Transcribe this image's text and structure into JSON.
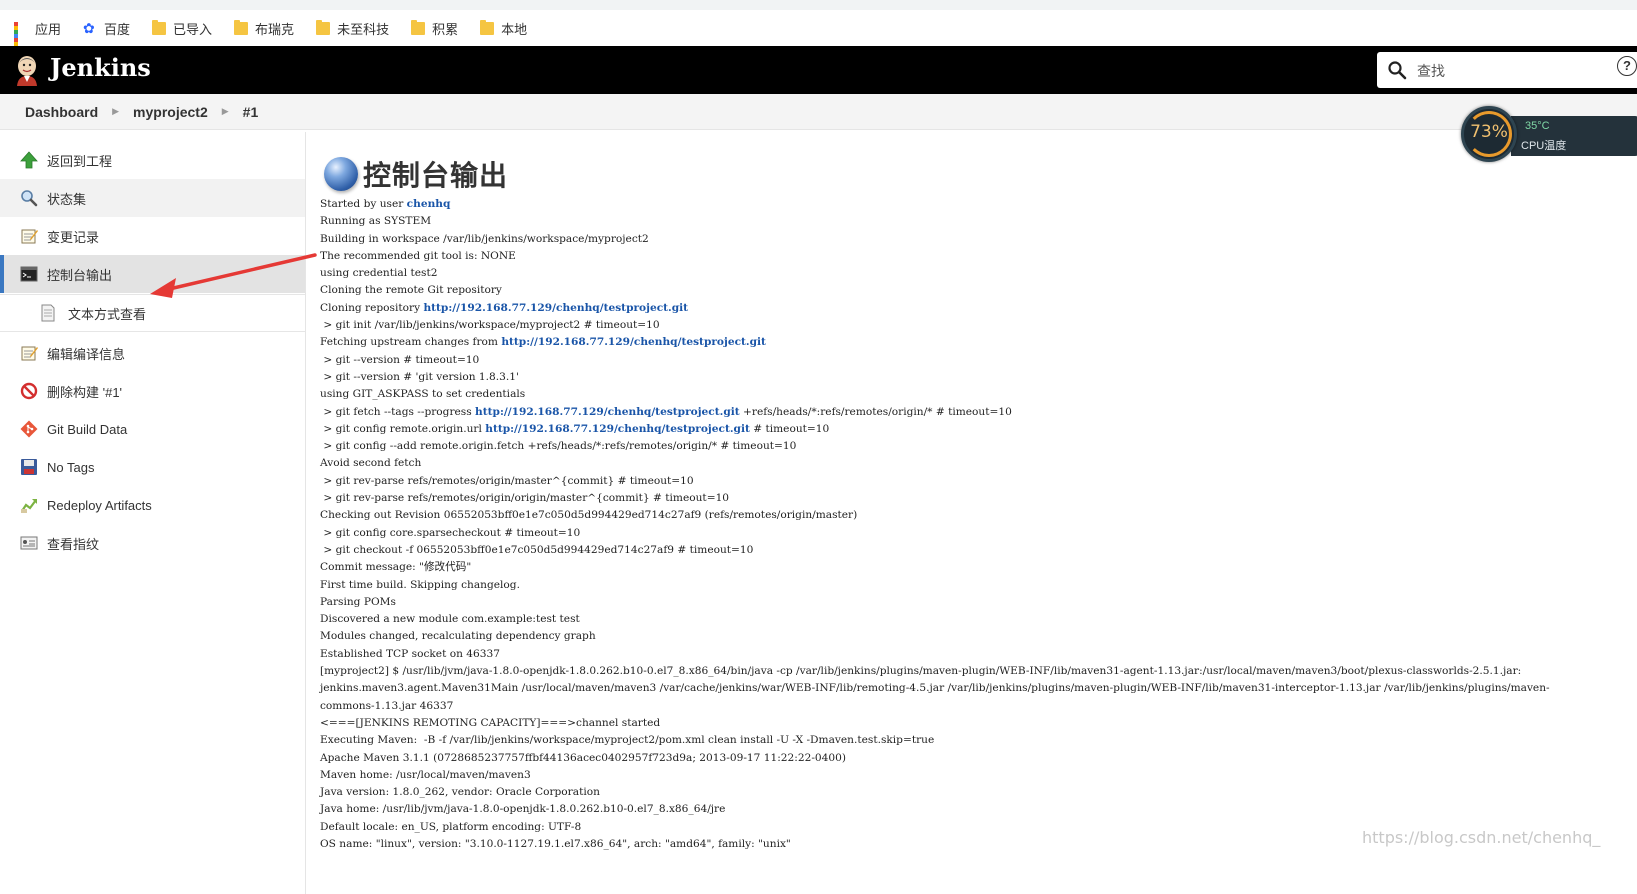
{
  "bookmarks": [
    {
      "label": "应用",
      "icon": "apps-grid-icon"
    },
    {
      "label": "百度",
      "icon": "baidu-paw-icon"
    },
    {
      "label": "已导入",
      "icon": "folder-icon"
    },
    {
      "label": "布瑞克",
      "icon": "folder-icon"
    },
    {
      "label": "未至科技",
      "icon": "folder-icon"
    },
    {
      "label": "积累",
      "icon": "folder-icon"
    },
    {
      "label": "本地",
      "icon": "folder-icon"
    }
  ],
  "header": {
    "brand": "Jenkins",
    "search_placeholder": "查找",
    "help": "?"
  },
  "breadcrumb": [
    "Dashboard",
    "myproject2",
    "#1"
  ],
  "sidebar": {
    "items": [
      {
        "label": "返回到工程",
        "icon": "up-arrow-icon"
      },
      {
        "label": "状态集",
        "icon": "magnifier-icon"
      },
      {
        "label": "变更记录",
        "icon": "notepad-icon"
      },
      {
        "label": "控制台输出",
        "icon": "terminal-icon"
      },
      {
        "label": "文本方式查看",
        "icon": "document-icon"
      },
      {
        "label": "编辑编译信息",
        "icon": "notepad-icon"
      },
      {
        "label": "删除构建 '#1'",
        "icon": "no-entry-icon"
      },
      {
        "label": "Git Build Data",
        "icon": "git-icon"
      },
      {
        "label": "No Tags",
        "icon": "floppy-icon"
      },
      {
        "label": "Redeploy Artifacts",
        "icon": "redeploy-icon"
      },
      {
        "label": "查看指纹",
        "icon": "fingerprint-card-icon"
      }
    ]
  },
  "main": {
    "title": "控制台输出",
    "console": [
      {
        "pre": "Started by user ",
        "link": "chenhq",
        "post": ""
      },
      {
        "pre": "Running as SYSTEM"
      },
      {
        "pre": "Building in workspace /var/lib/jenkins/workspace/myproject2"
      },
      {
        "pre": "The recommended git tool is: NONE"
      },
      {
        "pre": "using credential test2"
      },
      {
        "pre": "Cloning the remote Git repository"
      },
      {
        "pre": "Cloning repository ",
        "link": "http://192.168.77.129/chenhq/testproject.git",
        "post": ""
      },
      {
        "pre": " > git init /var/lib/jenkins/workspace/myproject2 # timeout=10"
      },
      {
        "pre": "Fetching upstream changes from ",
        "link": "http://192.168.77.129/chenhq/testproject.git",
        "post": ""
      },
      {
        "pre": " > git --version # timeout=10"
      },
      {
        "pre": " > git --version # 'git version 1.8.3.1'"
      },
      {
        "pre": "using GIT_ASKPASS to set credentials"
      },
      {
        "pre": " > git fetch --tags --progress ",
        "link": "http://192.168.77.129/chenhq/testproject.git",
        "post": " +refs/heads/*:refs/remotes/origin/* # timeout=10"
      },
      {
        "pre": " > git config remote.origin.url ",
        "link": "http://192.168.77.129/chenhq/testproject.git",
        "post": " # timeout=10"
      },
      {
        "pre": " > git config --add remote.origin.fetch +refs/heads/*:refs/remotes/origin/* # timeout=10"
      },
      {
        "pre": "Avoid second fetch"
      },
      {
        "pre": " > git rev-parse refs/remotes/origin/master^{commit} # timeout=10"
      },
      {
        "pre": " > git rev-parse refs/remotes/origin/origin/master^{commit} # timeout=10"
      },
      {
        "pre": "Checking out Revision 06552053bff0e1e7c050d5d994429ed714c27af9 (refs/remotes/origin/master)"
      },
      {
        "pre": " > git config core.sparsecheckout # timeout=10"
      },
      {
        "pre": " > git checkout -f 06552053bff0e1e7c050d5d994429ed714c27af9 # timeout=10"
      },
      {
        "pre": "Commit message: \"修改代码\""
      },
      {
        "pre": "First time build. Skipping changelog."
      },
      {
        "pre": "Parsing POMs"
      },
      {
        "pre": "Discovered a new module com.example:test test"
      },
      {
        "pre": "Modules changed, recalculating dependency graph"
      },
      {
        "pre": "Established TCP socket on 46337"
      },
      {
        "pre": "[myproject2] $ /usr/lib/jvm/java-1.8.0-openjdk-1.8.0.262.b10-0.el7_8.x86_64/bin/java -cp /var/lib/jenkins/plugins/maven-plugin/WEB-INF/lib/maven31-agent-1.13.jar:/usr/local/maven/maven3/boot/plexus-classworlds-2.5.1.jar:"
      },
      {
        "pre": "jenkins.maven3.agent.Maven31Main /usr/local/maven/maven3 /var/cache/jenkins/war/WEB-INF/lib/remoting-4.5.jar /var/lib/jenkins/plugins/maven-plugin/WEB-INF/lib/maven31-interceptor-1.13.jar /var/lib/jenkins/plugins/maven-"
      },
      {
        "pre": "commons-1.13.jar 46337"
      },
      {
        "pre": "<===[JENKINS REMOTING CAPACITY]===>channel started"
      },
      {
        "pre": "Executing Maven:  -B -f /var/lib/jenkins/workspace/myproject2/pom.xml clean install -U -X -Dmaven.test.skip=true"
      },
      {
        "pre": "Apache Maven 3.1.1 (0728685237757ffbf44136acec0402957f723d9a; 2013-09-17 11:22:22-0400)"
      },
      {
        "pre": "Maven home: /usr/local/maven/maven3"
      },
      {
        "pre": "Java version: 1.8.0_262, vendor: Oracle Corporation"
      },
      {
        "pre": "Java home: /usr/lib/jvm/java-1.8.0-openjdk-1.8.0.262.b10-0.el7_8.x86_64/jre"
      },
      {
        "pre": "Default locale: en_US, platform encoding: UTF-8"
      },
      {
        "pre": "OS name: \"linux\", version: \"3.10.0-1127.19.1.el7.x86_64\", arch: \"amd64\", family: \"unix\""
      }
    ]
  },
  "cpu_widget": {
    "percent": "73%",
    "temp": "35°C",
    "label": "CPU温度"
  },
  "watermark": "https://blog.csdn.net/chenhq_",
  "colors": {
    "link": "#1a55a8",
    "active_border": "#3b78c1",
    "header_bg": "#000000",
    "arrow": "#e53935"
  }
}
